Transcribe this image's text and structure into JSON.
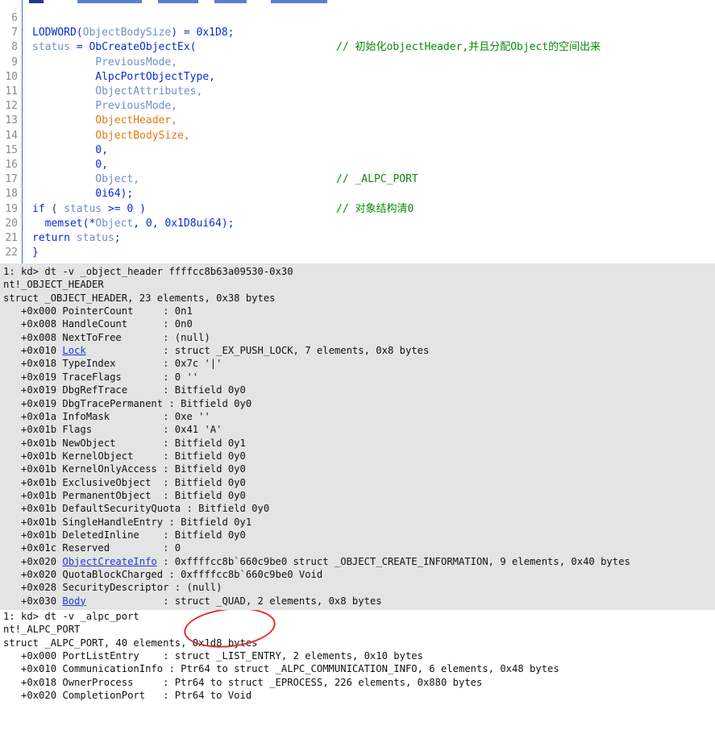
{
  "editor": {
    "lines": [
      {
        "num": "6",
        "tokens": [],
        "comment": ""
      },
      {
        "num": "7",
        "tokens": [
          {
            "t": "LODWORD(",
            "c": "pl"
          },
          {
            "t": "ObjectBodySize",
            "c": "var"
          },
          {
            "t": ") = 0x1D8;",
            "c": "pl"
          }
        ],
        "comment": ""
      },
      {
        "num": "8",
        "tokens": [
          {
            "t": "status",
            "c": "var"
          },
          {
            "t": " = ObCreateObjectEx(",
            "c": "pl"
          }
        ],
        "comment": "// 初始化objectHeader,并且分配Object的空间出来"
      },
      {
        "num": "9",
        "tokens": [
          {
            "t": "          PreviousMode,",
            "c": "var"
          }
        ],
        "comment": ""
      },
      {
        "num": "10",
        "tokens": [
          {
            "t": "          AlpcPortObjectType,",
            "c": "pl"
          }
        ],
        "comment": ""
      },
      {
        "num": "11",
        "tokens": [
          {
            "t": "          ObjectAttributes,",
            "c": "var"
          }
        ],
        "comment": ""
      },
      {
        "num": "12",
        "tokens": [
          {
            "t": "          PreviousMode,",
            "c": "var"
          }
        ],
        "comment": ""
      },
      {
        "num": "13",
        "tokens": [
          {
            "t": "          ObjectHeader,",
            "c": "org"
          }
        ],
        "comment": ""
      },
      {
        "num": "14",
        "tokens": [
          {
            "t": "          ObjectBodySize,",
            "c": "org"
          }
        ],
        "comment": ""
      },
      {
        "num": "15",
        "tokens": [
          {
            "t": "          0,",
            "c": "pl"
          }
        ],
        "comment": ""
      },
      {
        "num": "16",
        "tokens": [
          {
            "t": "          0,",
            "c": "pl"
          }
        ],
        "comment": ""
      },
      {
        "num": "17",
        "tokens": [
          {
            "t": "          Object,",
            "c": "var"
          }
        ],
        "comment": "// _ALPC_PORT"
      },
      {
        "num": "18",
        "tokens": [
          {
            "t": "          0i64);",
            "c": "pl"
          }
        ],
        "comment": ""
      },
      {
        "num": "19",
        "tokens": [
          {
            "t": "if ( ",
            "c": "pl"
          },
          {
            "t": "status",
            "c": "var"
          },
          {
            "t": " >= 0 )",
            "c": "pl"
          }
        ],
        "comment": "// 对象结构清0"
      },
      {
        "num": "20",
        "tokens": [
          {
            "t": "  memset(*",
            "c": "pl"
          },
          {
            "t": "Object",
            "c": "var"
          },
          {
            "t": ", 0, 0x1D8ui64);",
            "c": "pl"
          }
        ],
        "comment": ""
      },
      {
        "num": "21",
        "tokens": [
          {
            "t": "return ",
            "c": "pl"
          },
          {
            "t": "status",
            "c": "var"
          },
          {
            "t": ";",
            "c": "pl"
          }
        ],
        "comment": ""
      },
      {
        "num": "22",
        "tokens": [
          {
            "t": "}",
            "c": "pl"
          }
        ],
        "comment": ""
      }
    ]
  },
  "debugger": {
    "lines": [
      {
        "text": "1: kd> dt -v _object_header ffffcc8b63a09530-0x30"
      },
      {
        "text": "nt!_OBJECT_HEADER"
      },
      {
        "text": "struct _OBJECT_HEADER, 23 elements, 0x38 bytes"
      },
      {
        "text": "   +0x000 PointerCount     : 0n1"
      },
      {
        "text": "   +0x008 HandleCount      : 0n0"
      },
      {
        "text": "   +0x008 NextToFree       : (null)"
      },
      {
        "pre": "   +0x010 ",
        "link": "Lock",
        "post": "             : struct _EX_PUSH_LOCK, 7 elements, 0x8 bytes"
      },
      {
        "text": "   +0x018 TypeIndex        : 0x7c '|'"
      },
      {
        "text": "   +0x019 TraceFlags       : 0 ''"
      },
      {
        "text": "   +0x019 DbgRefTrace      : Bitfield 0y0"
      },
      {
        "text": "   +0x019 DbgTracePermanent : Bitfield 0y0"
      },
      {
        "text": "   +0x01a InfoMask         : 0xe ''"
      },
      {
        "text": "   +0x01b Flags            : 0x41 'A'"
      },
      {
        "text": "   +0x01b NewObject        : Bitfield 0y1"
      },
      {
        "text": "   +0x01b KernelObject     : Bitfield 0y0"
      },
      {
        "text": "   +0x01b KernelOnlyAccess : Bitfield 0y0"
      },
      {
        "text": "   +0x01b ExclusiveObject  : Bitfield 0y0"
      },
      {
        "text": "   +0x01b PermanentObject  : Bitfield 0y0"
      },
      {
        "text": "   +0x01b DefaultSecurityQuota : Bitfield 0y0"
      },
      {
        "text": "   +0x01b SingleHandleEntry : Bitfield 0y1"
      },
      {
        "text": "   +0x01b DeletedInline    : Bitfield 0y0"
      },
      {
        "text": "   +0x01c Reserved         : 0"
      },
      {
        "pre": "   +0x020 ",
        "link": "ObjectCreateInfo",
        "post": " : 0xffffcc8b`660c9be0 struct _OBJECT_CREATE_INFORMATION, 9 elements, 0x40 bytes"
      },
      {
        "text": "   +0x020 QuotaBlockCharged : 0xffffcc8b`660c9be0 Void"
      },
      {
        "text": "   +0x028 SecurityDescriptor : (null)"
      },
      {
        "pre": "   +0x030 ",
        "link": "Body",
        "post": "             : struct _QUAD, 2 elements, 0x8 bytes"
      }
    ]
  },
  "output": {
    "lines": [
      {
        "text": "1: kd> dt -v _alpc_port"
      },
      {
        "text": "nt!_ALPC_PORT"
      },
      {
        "text": "struct _ALPC_PORT, 40 elements, 0x1d8 bytes"
      },
      {
        "text": "   +0x000 PortListEntry    : struct _LIST_ENTRY, 2 elements, 0x10 bytes"
      },
      {
        "text": "   +0x010 CommunicationInfo : Ptr64 to struct _ALPC_COMMUNICATION_INFO, 6 elements, 0x48 bytes"
      },
      {
        "text": "   +0x018 OwnerProcess     : Ptr64 to struct _EPROCESS, 226 elements, 0x880 bytes"
      },
      {
        "text": "   +0x020 CompletionPort   : Ptr64 to Void"
      }
    ]
  },
  "colors": {
    "annotation_circle": "#e0312a",
    "debugger_bg": "#e4e4e4",
    "link": "#1a3bd6",
    "comment": "#0a8a0a"
  }
}
